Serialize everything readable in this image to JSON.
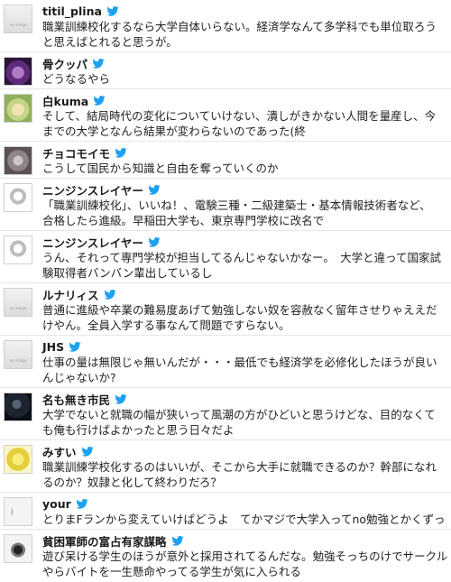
{
  "accent_color": "#1da1f2",
  "verified_icon": "twitter-bird-icon",
  "avatar_placeholder_text": "no image",
  "tweets": [
    {
      "user": "titil_plina",
      "lines": [
        "職業訓練校化するなら大学自体いらない。経済学なんて多学科でも単位取ろう",
        "と思えばとれると思うが。"
      ]
    },
    {
      "user": "骨クッパ",
      "lines": [
        "どうなるやら"
      ]
    },
    {
      "user": "白kuma",
      "lines": [
        "そして、結局時代の変化についていけない、潰しがきかない人間を量産し、今",
        "までの大学となんら結果が変わらないのであった(終"
      ]
    },
    {
      "user": "チョコモイモ",
      "lines": [
        "こうして国民から知識と自由を奪っていくのか"
      ]
    },
    {
      "user": "ニンジンスレイヤー",
      "lines": [
        "「職業訓練校化」、いいね！、電験三種・二級建築士・基本情報技術者など、",
        "合格したら進級。早稲田大学も、東京専門学校に改名で"
      ]
    },
    {
      "user": "ニンジンスレイヤー",
      "lines": [
        "うん、それって専門学校が担当してるんじゃないかなー。　大学と違って国家試",
        "験取得者バンバン輩出しているし"
      ]
    },
    {
      "user": "ルナリィス",
      "lines": [
        "普通に進級や卒業の難易度あげて勉強しない奴を容赦なく留年させりゃええだ",
        "けやん。全員入学する事なんて問題ですらない。"
      ]
    },
    {
      "user": "JHS",
      "lines": [
        "仕事の量は無限じゃ無いんだが・・・最低でも経済学を必修化したほうが良い",
        "んじゃないか?"
      ]
    },
    {
      "user": "名も無き市民",
      "lines": [
        "大学でないと就職の幅が狭いって風潮の方がひどいと思うけどな、目的なくて",
        "も俺も行けばよかったと思う日々だよ"
      ]
    },
    {
      "user": "みすい",
      "lines": [
        "職業訓練学校化するのはいいが、そこから大手に就職できるのか？幹部になれ",
        "るのか？奴隷と化して終わりだろ？"
      ]
    },
    {
      "user": "your",
      "lines": [
        "とりまFランから変えていけばどうよ　てかマジで大学入ってno勉強とかくずっ"
      ]
    },
    {
      "user": "貧困軍師の富占有家謀略",
      "lines": [
        "遊び呆ける学生のほうが意外と採用されてるんだな。勉強そっちのけでサークル",
        "やらバイトを一生懸命やってる学生が気に入られる"
      ]
    }
  ]
}
